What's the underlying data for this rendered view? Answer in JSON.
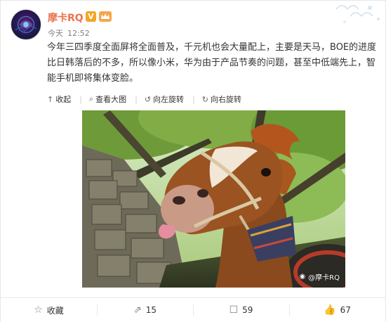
{
  "post": {
    "username": "摩卡RQ",
    "verified_badge": "V",
    "date_label": "今天",
    "time": "12:52",
    "text": "今年三四季度全面屏将全面普及，千元机也会大量配上，主要是天马，BOE的进度比日韩落后的不多，所以像小米，华为由于产品节奏的问题，甚至中低端先上，智能手机即将集体变脸。"
  },
  "image_toolbar": {
    "collapse": "收起",
    "view_large": "查看大图",
    "rotate_left": "向左旋转",
    "rotate_right": "向右旋转"
  },
  "photo": {
    "watermark": "@摩卡RQ",
    "description_icon": "horse-photo"
  },
  "footer": {
    "favorite": "收藏",
    "repost_count": "15",
    "comment_count": "59",
    "like_count": "67"
  },
  "colors": {
    "username": "#eb7350",
    "badge": "#f4a623",
    "icon_gray": "#808080"
  }
}
